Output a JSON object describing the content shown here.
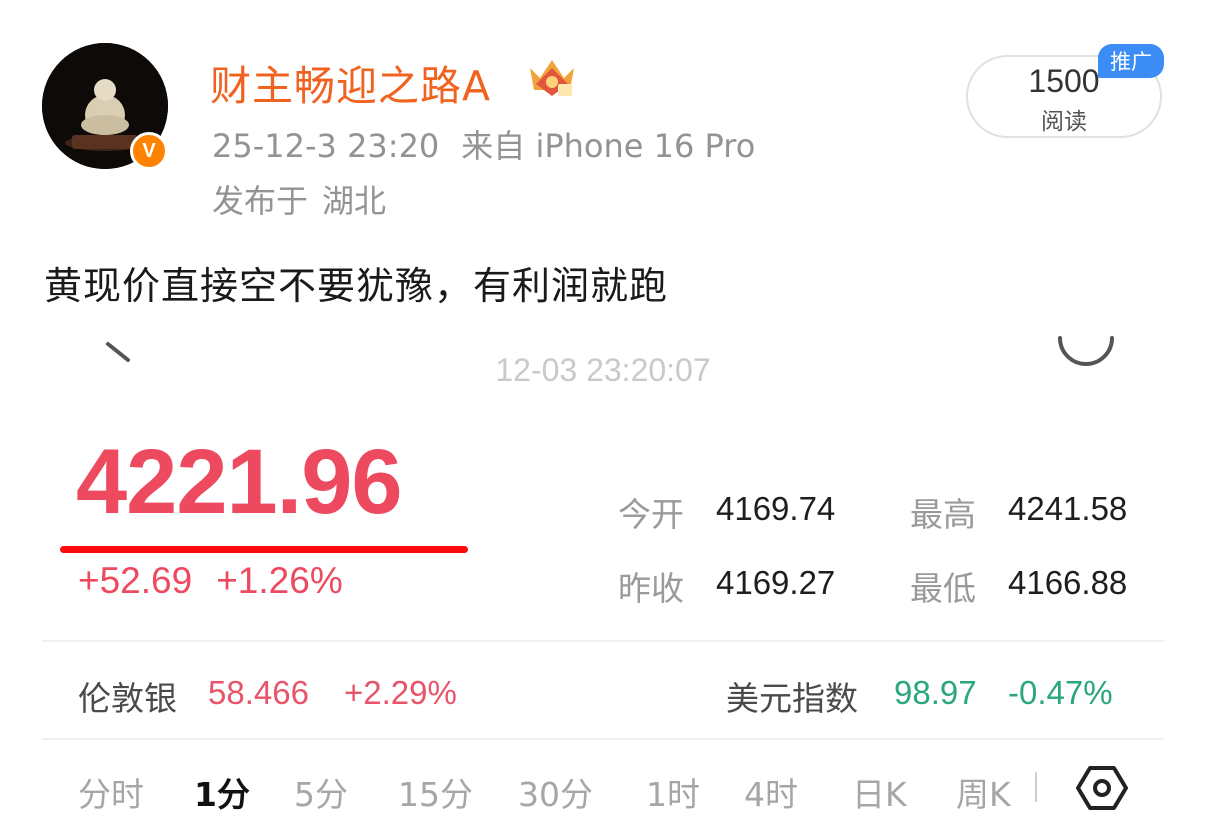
{
  "post": {
    "author": {
      "name": "财主畅迎之路A",
      "verified_badge": "V",
      "icons": [
        "avatar-image",
        "verified-icon",
        "crown-icon"
      ]
    },
    "time": "25-12-3 23:20",
    "source": "来自 iPhone 16 Pro",
    "location_prefix": "发布于",
    "location": "湖北",
    "reads": {
      "count": "1500",
      "label": "阅读",
      "badge": "推广"
    },
    "text": "黄现价直接空不要犹豫，有利润就跑"
  },
  "quote": {
    "timestamp": "12-03 23:20:07",
    "price": "4221.96",
    "change": "+52.69",
    "change_pct": "+1.26%",
    "stats": {
      "open_label": "今开",
      "open": "4169.74",
      "high_label": "最高",
      "high": "4241.58",
      "prev_close_label": "昨收",
      "prev_close": "4169.27",
      "low_label": "最低",
      "low": "4166.88"
    },
    "related": {
      "silver_label": "伦敦银",
      "silver_price": "58.466",
      "silver_change": "+2.29%",
      "dxy_label": "美元指数",
      "dxy_price": "98.97",
      "dxy_change": "-0.47%"
    },
    "tabs": [
      "分时",
      "1分",
      "5分",
      "15分",
      "30分",
      "1时",
      "4时",
      "日K",
      "周K"
    ],
    "active_tab": "1分",
    "colors": {
      "up": "#ee4a5f",
      "down": "#2aa87a",
      "author": "#f0621f",
      "highlight_underline": "#ff0a0a",
      "promo": "#3b8cf5"
    },
    "icons": [
      "back-icon",
      "refresh-icon",
      "chart-settings-icon"
    ]
  }
}
